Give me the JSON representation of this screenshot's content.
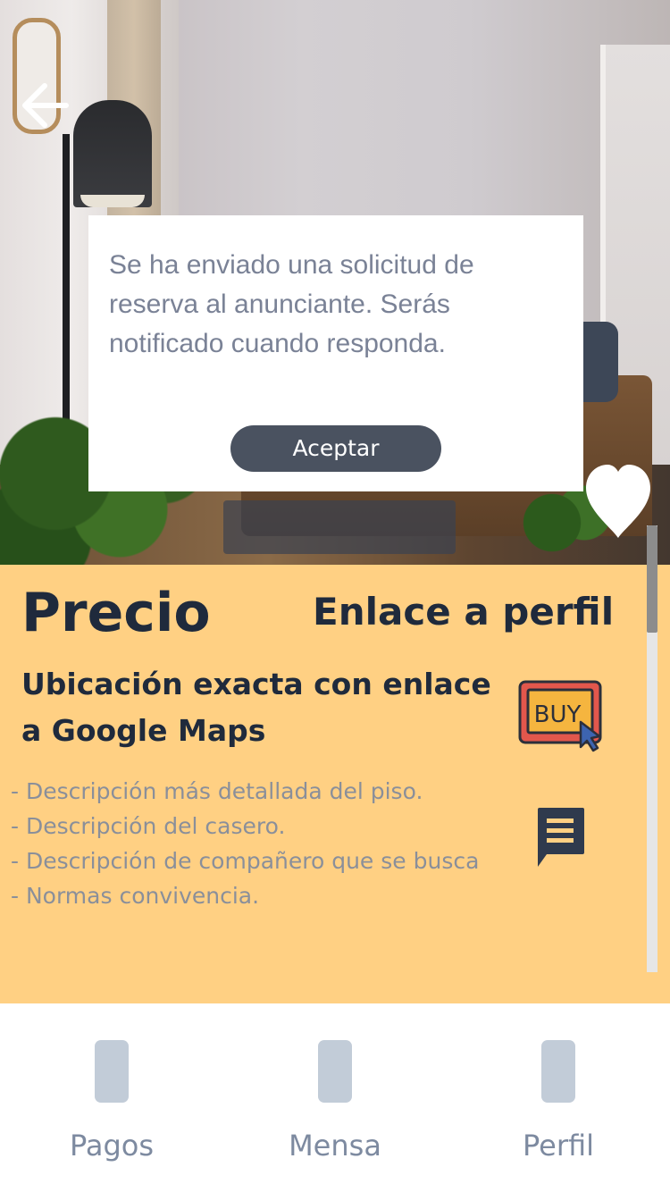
{
  "header": {
    "back_icon": "arrow-left-icon",
    "favorite_icon": "heart-icon"
  },
  "listing": {
    "price_label": "Precio",
    "profile_link_label": "Enlace a perfil",
    "location_text": "Ubicación exacta con enlace a Google Maps",
    "description_lines": [
      "- Descripción más detallada del piso.",
      "- Descripción del casero.",
      "- Descripción de compañero que se busca",
      "- Normas convivencia."
    ],
    "buy_button_text": "BUY",
    "chat_icon": "message-icon"
  },
  "modal": {
    "message": "Se ha enviado una solicitud de reserva al anunciante. Serás notificado cuando responda.",
    "accept_label": "Aceptar"
  },
  "bottom_nav": {
    "items": [
      {
        "label": "Pagos",
        "icon": "payments-icon"
      },
      {
        "label": "Mensa",
        "icon": "messages-icon"
      },
      {
        "label": "Perfil",
        "icon": "profile-icon"
      }
    ]
  },
  "colors": {
    "details_background": "#ffd083",
    "heading_text": "#1f2a3c",
    "muted_text": "#8a8f9a",
    "modal_button": "#4a5260",
    "nav_icon": "#c2ccd8",
    "nav_label": "#7d8aa0"
  }
}
